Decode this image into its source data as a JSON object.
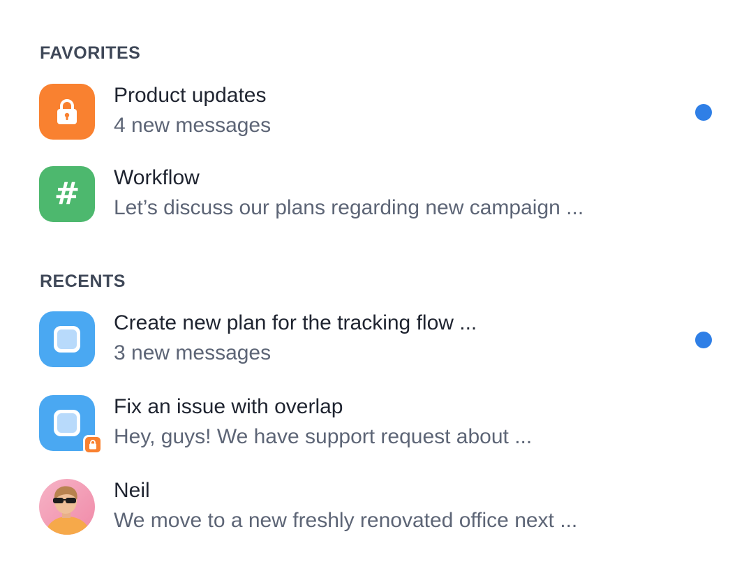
{
  "favorites": {
    "heading": "FAVORITES",
    "items": [
      {
        "title": "Product updates",
        "subtitle": "4 new messages",
        "icon": "lock-icon",
        "icon_color": "#f98130",
        "unread": true
      },
      {
        "title": "Workflow",
        "subtitle": "Let’s discuss our plans regarding new campaign ...",
        "icon": "hash-icon",
        "icon_color": "#4db86e",
        "unread": false
      }
    ]
  },
  "recents": {
    "heading": "RECENTS",
    "items": [
      {
        "title": "Create new plan for the tracking flow ...",
        "subtitle": "3 new messages",
        "icon": "square-icon",
        "icon_color": "#4aa8f2",
        "unread": true
      },
      {
        "title": "Fix an issue with overlap",
        "subtitle": "Hey, guys! We have support request about ...",
        "icon": "square-icon",
        "icon_color": "#4aa8f2",
        "badge_icon": "lock-badge-icon",
        "unread": false
      },
      {
        "title": "Neil",
        "subtitle": "We move to a new freshly renovated office next ...",
        "icon": "user-avatar",
        "unread": false
      }
    ]
  },
  "colors": {
    "unread_dot": "#2f7fe6",
    "heading": "#3f4858",
    "subtitle": "#5d6576"
  }
}
